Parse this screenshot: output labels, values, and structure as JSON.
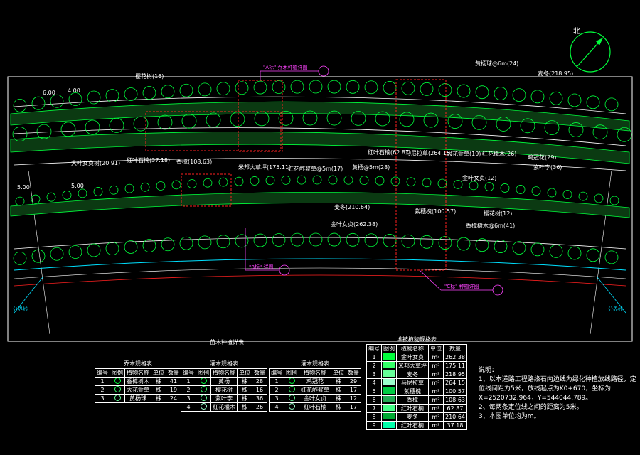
{
  "frame_title": "苗木种植详表",
  "north_label": "北",
  "plan": {
    "callouts": [
      {
        "text": "樱花树(16)"
      },
      {
        "text": "黄杨球@6m(24)"
      },
      {
        "text": "麦冬(218.95)"
      },
      {
        "text": "大叶女贞树(20.91)"
      },
      {
        "text": "红叶石楠(37.18)"
      },
      {
        "text": "香樟(108.63)"
      },
      {
        "text": "米邦大草坪(175.11)"
      },
      {
        "text": "马尼拉草(264.15)"
      },
      {
        "text": "红叶石楠(62.87)"
      },
      {
        "text": "大花萱草(19)"
      },
      {
        "text": "红花檵木(26)"
      },
      {
        "text": "鸡冠花(29)"
      },
      {
        "text": "紫叶李(36)"
      },
      {
        "text": "红花酢浆草@5m(17)"
      },
      {
        "text": "黄杨@5m(28)"
      },
      {
        "text": "麦冬(210.64)"
      },
      {
        "text": "金叶女贞(12)"
      },
      {
        "text": "樱花树(12)"
      },
      {
        "text": "紫穗槐(100.57)"
      },
      {
        "text": "金叶女贞(262.38)"
      },
      {
        "text": "香樟树木@6m(41)"
      }
    ],
    "left_marker": "分界线",
    "right_marker": "分界线",
    "magenta_notes": [
      "\"A标\" 乔木种植详图",
      "\"B标\" 详图",
      "\"C标\" 种植详图"
    ],
    "dims": [
      "6.00",
      "4.00",
      "4.00",
      "4.00",
      "5.00",
      "5.00"
    ]
  },
  "tables": {
    "arbor": {
      "title": "乔木规格表",
      "headers": [
        "编号",
        "图例",
        "植物名称",
        "单位",
        "数量"
      ],
      "rows": [
        [
          "1",
          "",
          "香樟树木",
          "株",
          "41"
        ],
        [
          "2",
          "",
          "大花萱草",
          "株",
          "19"
        ],
        [
          "3",
          "",
          "黄杨球",
          "株",
          "24"
        ]
      ]
    },
    "shrub": {
      "title": "灌木规格表",
      "headers": [
        "编号",
        "图例",
        "植物名称",
        "单位",
        "数量"
      ],
      "rows": [
        [
          "1",
          "",
          "黄杨",
          "株",
          "28"
        ],
        [
          "2",
          "",
          "樱花树",
          "株",
          "16"
        ],
        [
          "3",
          "",
          "紫叶李",
          "株",
          "36"
        ],
        [
          "4",
          "",
          "红花檵木",
          "株",
          "26"
        ]
      ]
    },
    "flower": {
      "title": "灌木规格表",
      "headers": [
        "编号",
        "图例",
        "植物名称",
        "单位",
        "数量"
      ],
      "rows": [
        [
          "1",
          "",
          "鸡冠花",
          "株",
          "29"
        ],
        [
          "2",
          "",
          "红花酢浆草",
          "株",
          "17"
        ],
        [
          "3",
          "",
          "金叶女贞",
          "株",
          "12"
        ],
        [
          "4",
          "",
          "红叶石楠",
          "株",
          "17"
        ]
      ]
    },
    "ground": {
      "title": "地被植物规格表",
      "headers": [
        "编号",
        "图例",
        "植物名称",
        "单位",
        "数量"
      ],
      "rows": [
        [
          "1",
          "",
          "金叶女贞",
          "m²",
          "262.38"
        ],
        [
          "2",
          "",
          "米邦大草坪",
          "m²",
          "175.11"
        ],
        [
          "3",
          "",
          "麦冬",
          "m²",
          "218.95"
        ],
        [
          "4",
          "",
          "马尼拉草",
          "m²",
          "264.15"
        ],
        [
          "5",
          "",
          "紫穗槐",
          "m²",
          "100.57"
        ],
        [
          "6",
          "",
          "香樟",
          "m²",
          "108.63"
        ],
        [
          "7",
          "",
          "红叶石楠",
          "m²",
          "62.87"
        ],
        [
          "8",
          "",
          "麦冬",
          "m²",
          "210.64"
        ],
        [
          "9",
          "",
          "红叶石楠",
          "m²",
          "37.18"
        ]
      ]
    }
  },
  "notes": {
    "heading": "说明：",
    "lines": [
      "1、以本道路工程路缘石内边线为绿化种植放线路径，定位线间距为5米，放线起点为K0+670，坐标为X=2520732.964，Y=544044.789。",
      "2、每两条定位线之间的距离为5米。",
      "3、本图单位均为m。"
    ]
  },
  "colors": {
    "background": "#000000",
    "lines": "#ffffff",
    "planting": "#00ff3c",
    "accent_magenta": "#ff44ff",
    "accent_red": "#ff2020",
    "accent_cyan": "#00e0ff"
  }
}
